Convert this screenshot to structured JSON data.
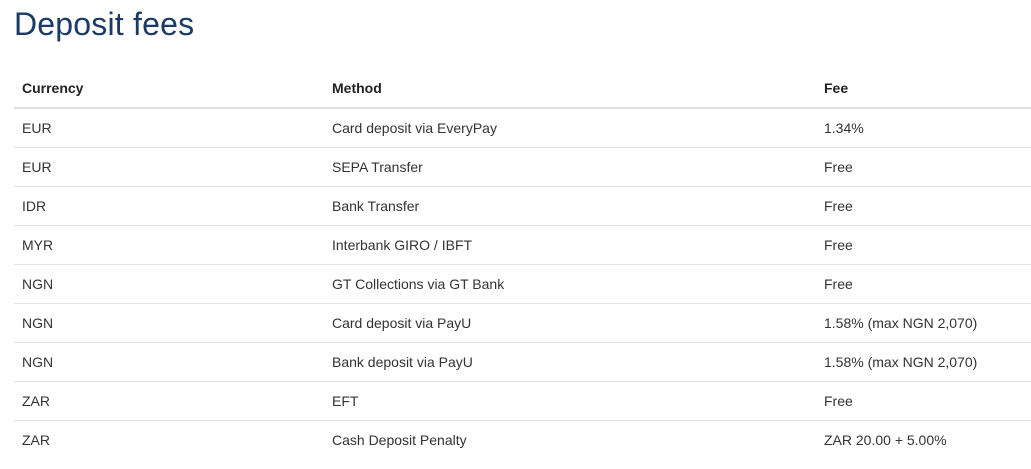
{
  "page": {
    "title": "Deposit fees"
  },
  "table": {
    "headers": {
      "currency": "Currency",
      "method": "Method",
      "fee": "Fee"
    },
    "rows": [
      {
        "currency": "EUR",
        "method": "Card deposit via EveryPay",
        "fee": "1.34%"
      },
      {
        "currency": "EUR",
        "method": "SEPA Transfer",
        "fee": "Free"
      },
      {
        "currency": "IDR",
        "method": "Bank Transfer",
        "fee": "Free"
      },
      {
        "currency": "MYR",
        "method": "Interbank GIRO / IBFT",
        "fee": "Free"
      },
      {
        "currency": "NGN",
        "method": "GT Collections via GT Bank",
        "fee": "Free"
      },
      {
        "currency": "NGN",
        "method": "Card deposit via PayU",
        "fee": "1.58% (max NGN 2,070)"
      },
      {
        "currency": "NGN",
        "method": "Bank deposit via PayU",
        "fee": "1.58% (max NGN 2,070)"
      },
      {
        "currency": "ZAR",
        "method": "EFT",
        "fee": "Free"
      },
      {
        "currency": "ZAR",
        "method": "Cash Deposit Penalty",
        "fee": "ZAR 20.00 + 5.00%"
      }
    ]
  },
  "colors": {
    "title": "#1b3a66",
    "text": "#333333",
    "border": "#e2e2e2"
  }
}
